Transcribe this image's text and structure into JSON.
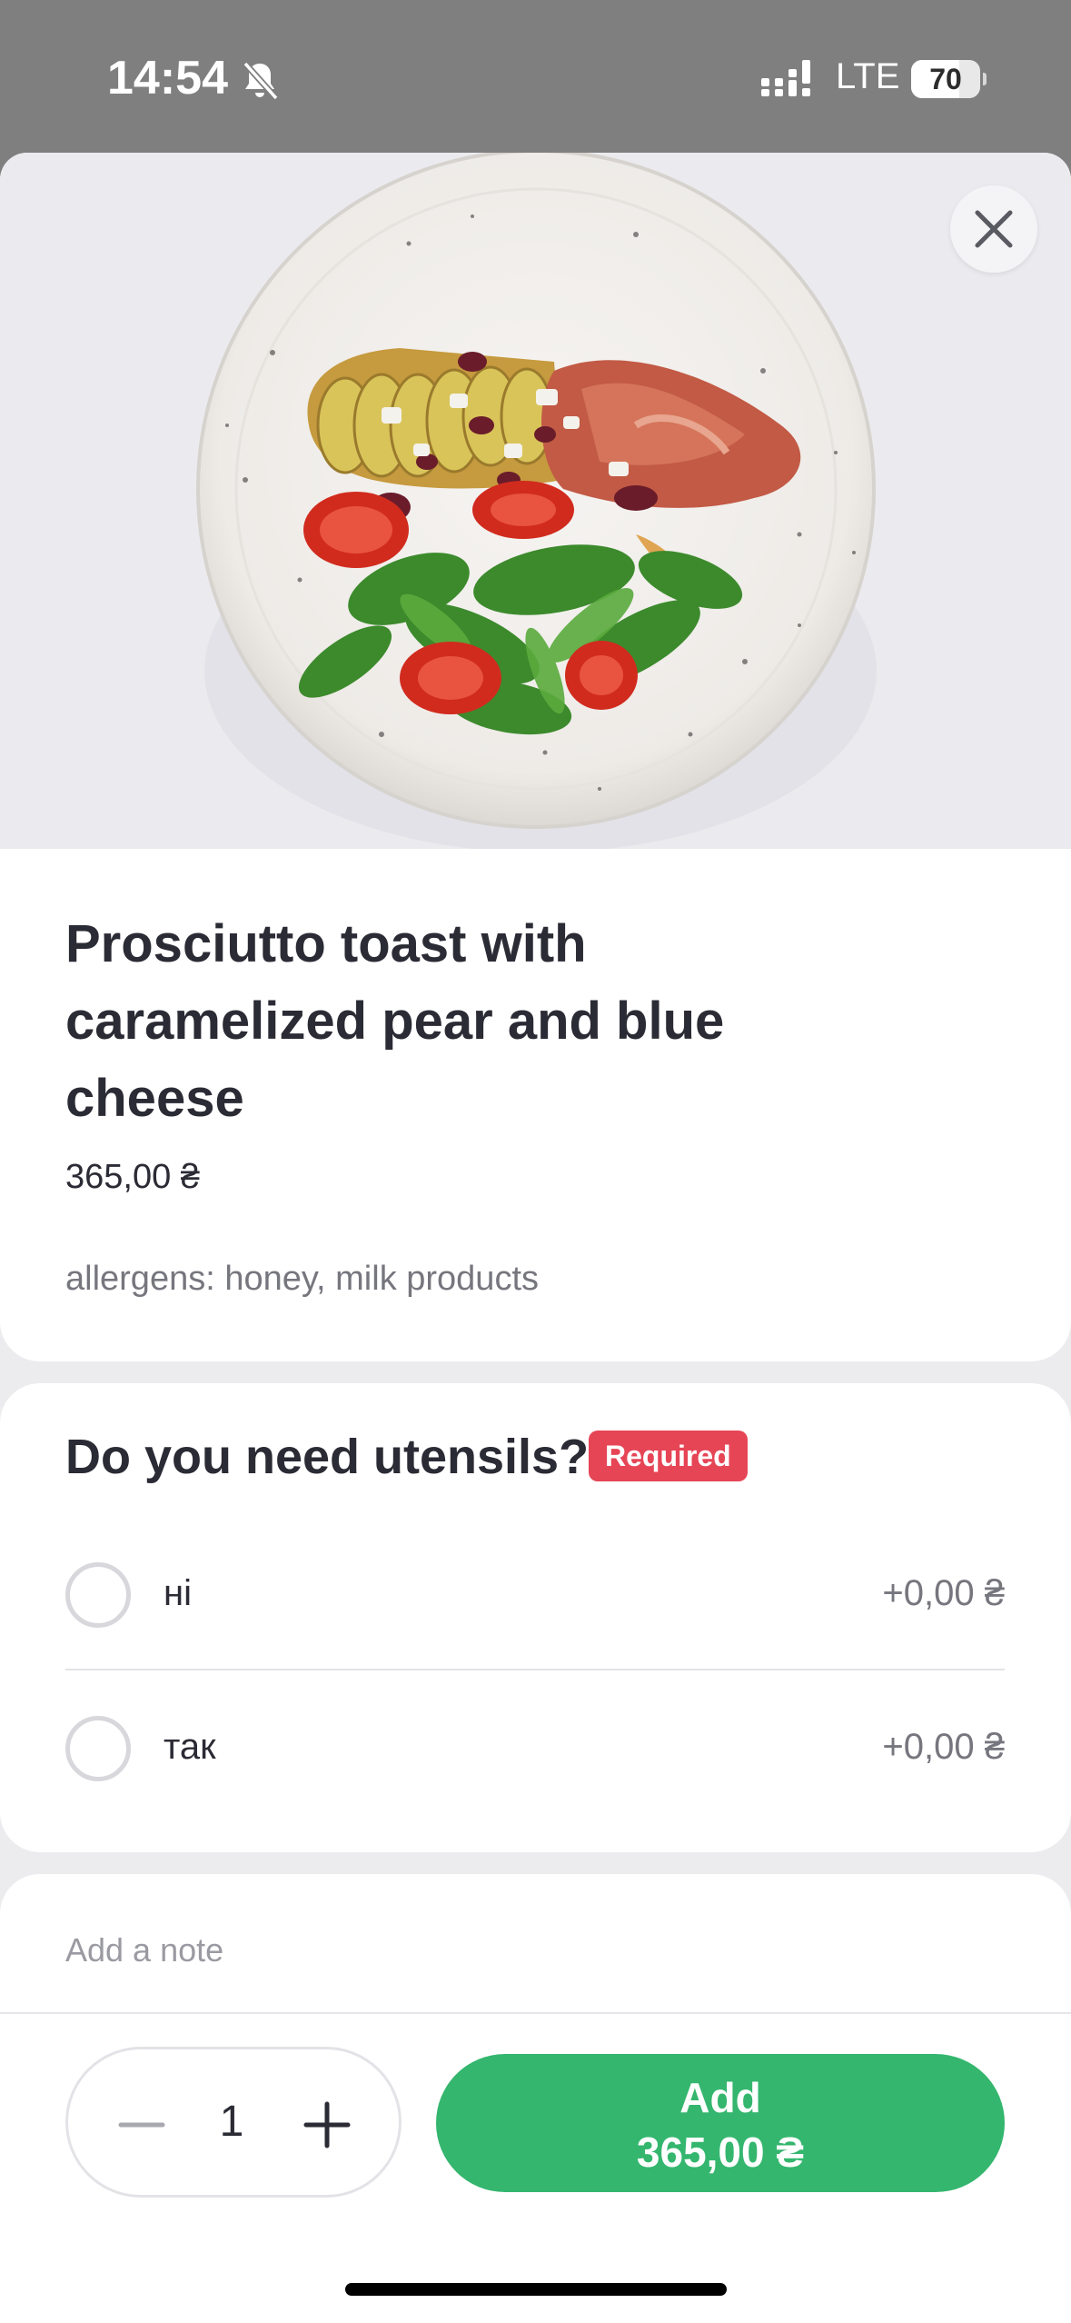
{
  "status_bar": {
    "time": "14:54",
    "network": "LTE",
    "battery": "70",
    "battery_level": 0.7
  },
  "hero": {
    "image_icon": "dish-photo",
    "close_icon": "close-icon"
  },
  "item": {
    "title": "Prosciutto toast with caramelized pear and blue cheese",
    "price": "365,00 ₴",
    "allergens": "allergens: honey, milk products"
  },
  "utensils": {
    "title": "Do you need utensils?",
    "badge": "Required",
    "options": [
      {
        "label": "ні",
        "price": "+0,00 ₴"
      },
      {
        "label": "так",
        "price": "+0,00 ₴"
      }
    ]
  },
  "note": {
    "placeholder": "Add a note"
  },
  "cart": {
    "quantity": "1",
    "add_label": "Add",
    "add_price": "365,00 ₴"
  },
  "colors": {
    "accent": "#34b66e",
    "required_badge": "#e64556",
    "text_primary": "#2b2b35",
    "text_secondary": "#76767e"
  }
}
